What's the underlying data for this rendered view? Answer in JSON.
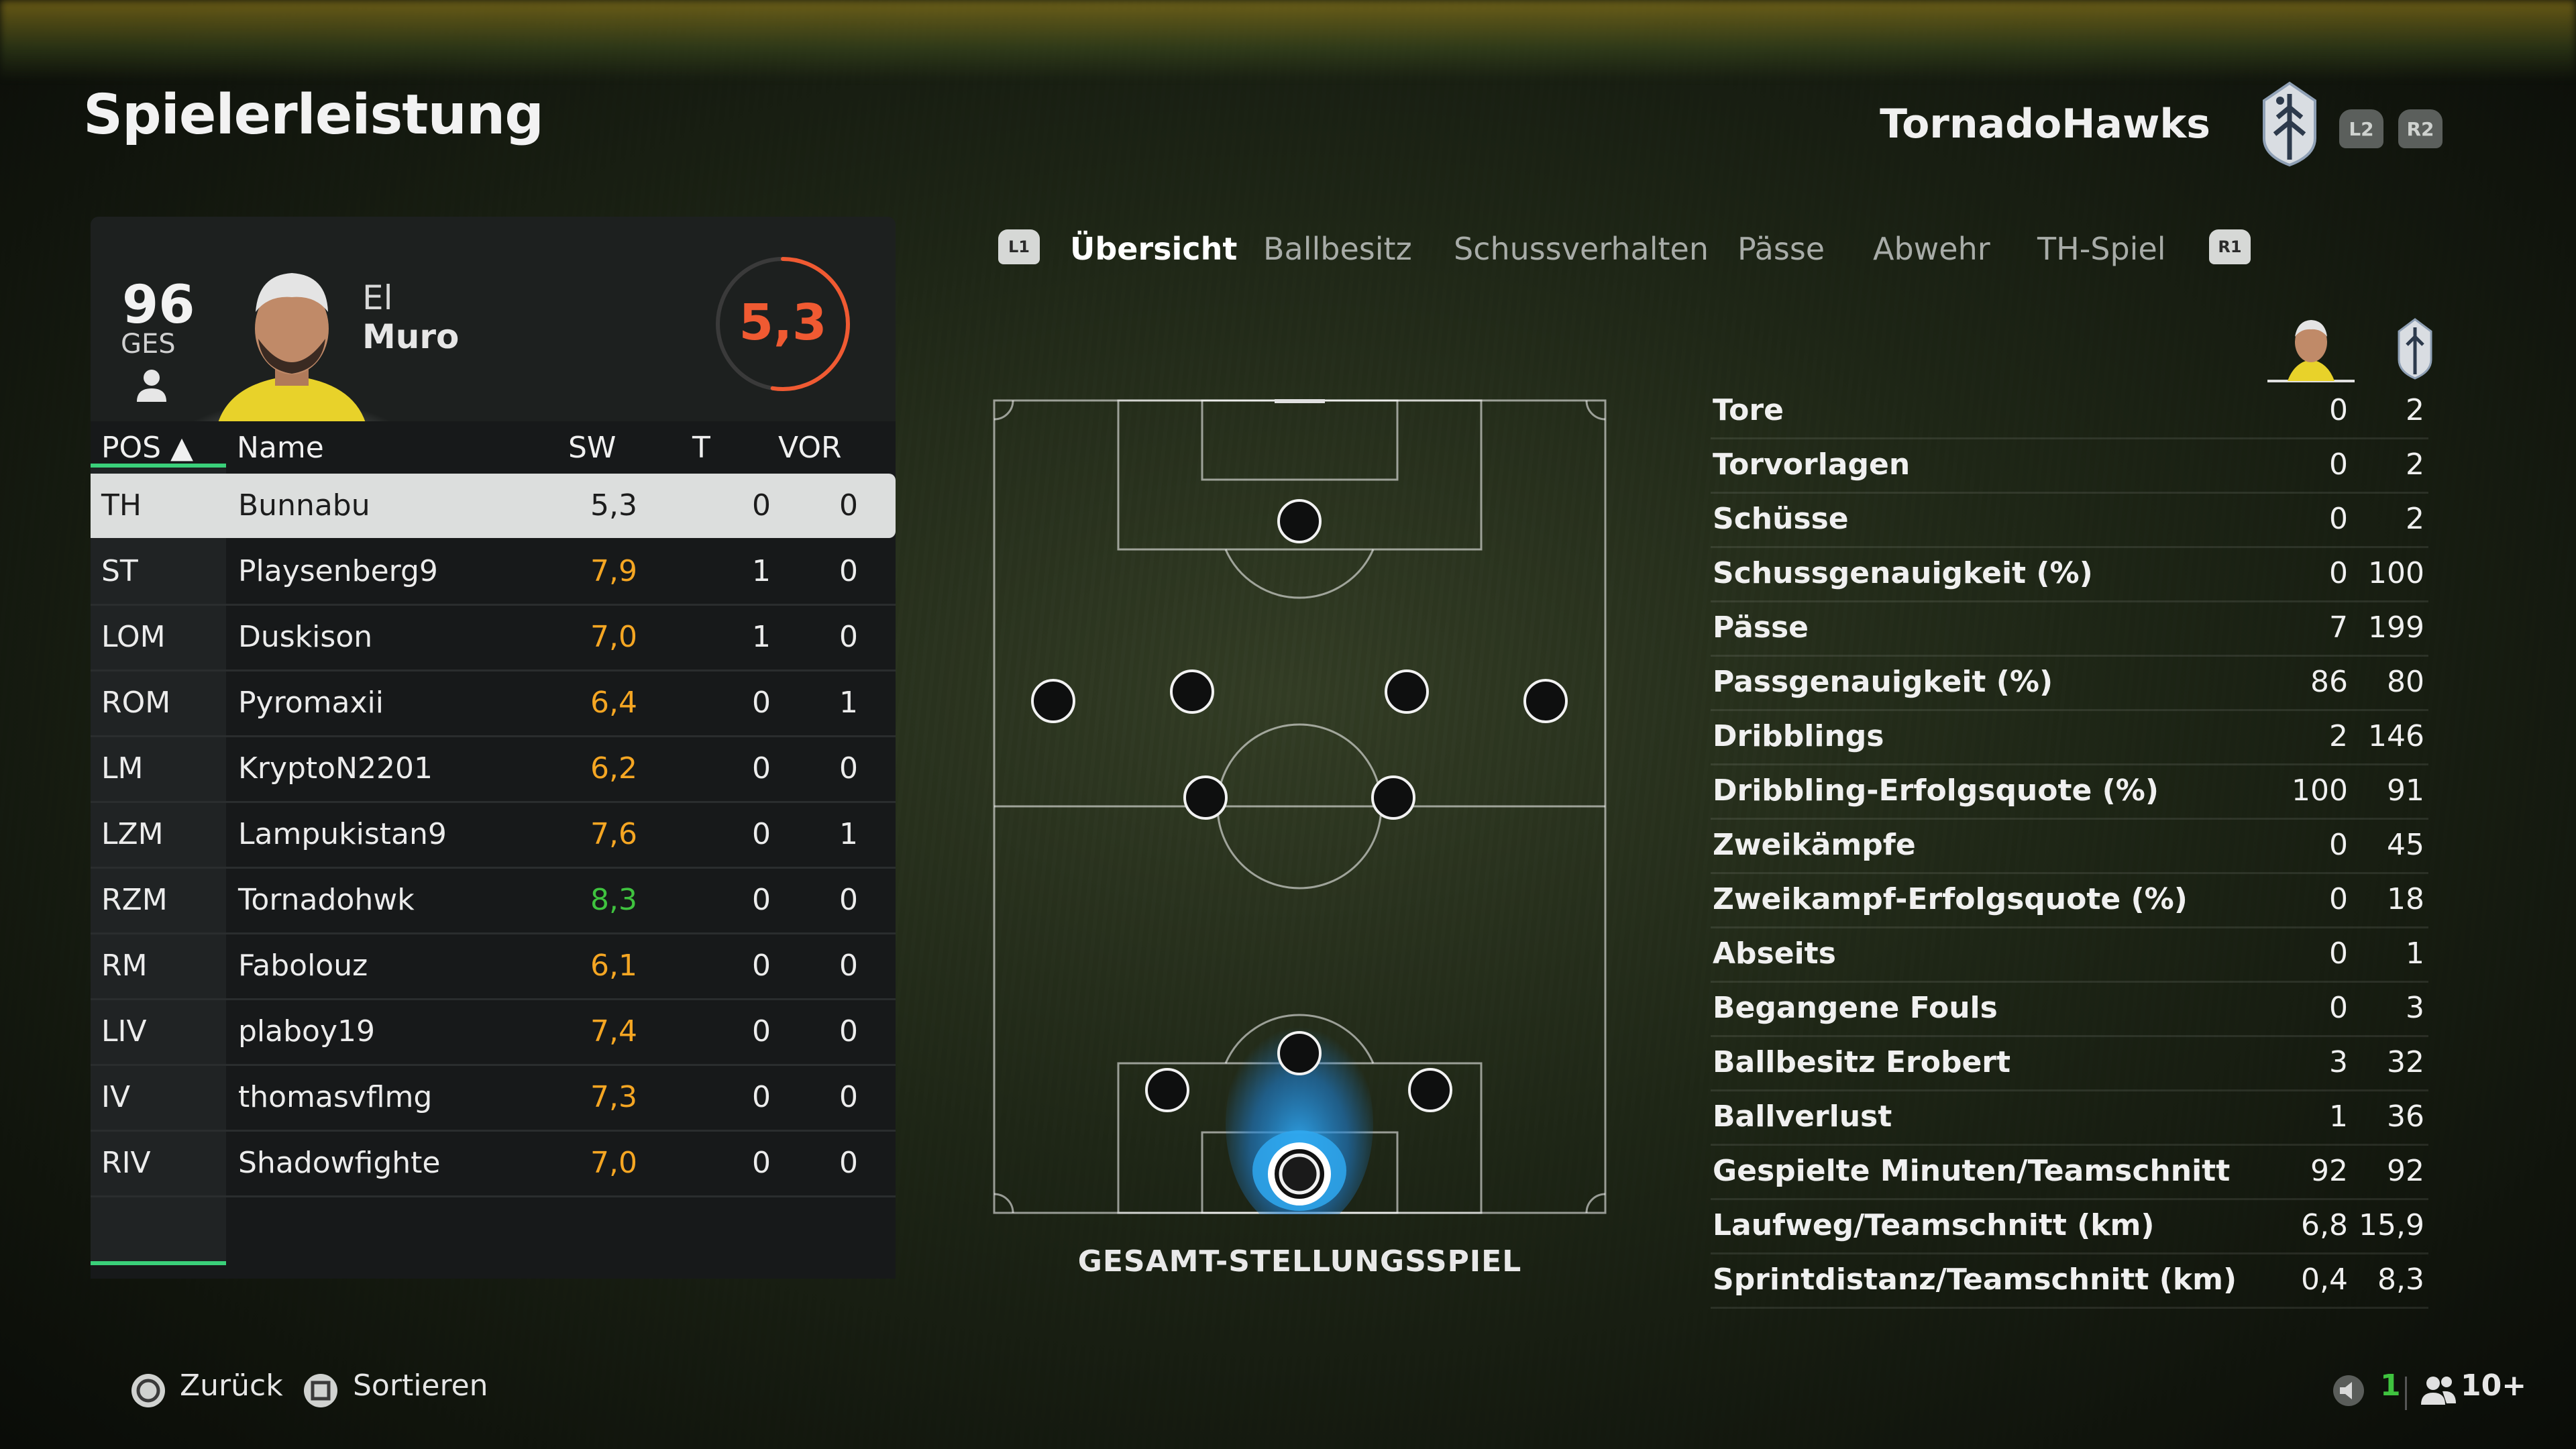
{
  "header": {
    "title": "Spielerleistung",
    "team_name": "TornadoHawks",
    "l2": "L2",
    "r2": "R2"
  },
  "player": {
    "ovr": "96",
    "ovr_label": "GES",
    "first_name": "El",
    "last_name": "Muro",
    "rating": "5,3"
  },
  "table": {
    "headers": {
      "pos": "POS ▲",
      "name": "Name",
      "sw": "SW",
      "t": "T",
      "vor": "VOR"
    },
    "rows": [
      {
        "pos": "TH",
        "name": "Bunnabu",
        "sw": "5,3",
        "t": "0",
        "vor": "0",
        "color": "#1c1c1c"
      },
      {
        "pos": "ST",
        "name": "Playsenberg9",
        "sw": "7,9",
        "t": "1",
        "vor": "0",
        "color": "#f5a623"
      },
      {
        "pos": "LOM",
        "name": "Duskison",
        "sw": "7,0",
        "t": "1",
        "vor": "0",
        "color": "#f5a623"
      },
      {
        "pos": "ROM",
        "name": "Pyromaxii",
        "sw": "6,4",
        "t": "0",
        "vor": "1",
        "color": "#f5a623"
      },
      {
        "pos": "LM",
        "name": "KryptoN2201",
        "sw": "6,2",
        "t": "0",
        "vor": "0",
        "color": "#f5a623"
      },
      {
        "pos": "LZM",
        "name": "Lampukistan9",
        "sw": "7,6",
        "t": "0",
        "vor": "1",
        "color": "#f5a623"
      },
      {
        "pos": "RZM",
        "name": "Tornadohwk",
        "sw": "8,3",
        "t": "0",
        "vor": "0",
        "color": "#3fc33f"
      },
      {
        "pos": "RM",
        "name": "Fabolouz",
        "sw": "6,1",
        "t": "0",
        "vor": "0",
        "color": "#f5a623"
      },
      {
        "pos": "LIV",
        "name": "plaboy19",
        "sw": "7,4",
        "t": "0",
        "vor": "0",
        "color": "#f5a623"
      },
      {
        "pos": "IV",
        "name": "thomasvflmg",
        "sw": "7,3",
        "t": "0",
        "vor": "0",
        "color": "#f5a623"
      },
      {
        "pos": "RIV",
        "name": "Shadowfighte",
        "sw": "7,0",
        "t": "0",
        "vor": "0",
        "color": "#f5a623"
      }
    ]
  },
  "tabs": {
    "l1": "L1",
    "r1": "R1",
    "items": [
      "Übersicht",
      "Ballbesitz",
      "Schussverhalten",
      "Pässe",
      "Abwehr",
      "TH-Spiel"
    ]
  },
  "pitch_label": "GESAMT-STELLUNGSSPIEL",
  "stats": [
    {
      "label": "Tore",
      "player": "0",
      "team": "2"
    },
    {
      "label": "Torvorlagen",
      "player": "0",
      "team": "2"
    },
    {
      "label": "Schüsse",
      "player": "0",
      "team": "2"
    },
    {
      "label": "Schussgenauigkeit (%)",
      "player": "0",
      "team": "100"
    },
    {
      "label": "Pässe",
      "player": "7",
      "team": "199"
    },
    {
      "label": "Passgenauigkeit (%)",
      "player": "86",
      "team": "80"
    },
    {
      "label": "Dribblings",
      "player": "2",
      "team": "146"
    },
    {
      "label": "Dribbling-Erfolgsquote (%)",
      "player": "100",
      "team": "91"
    },
    {
      "label": "Zweikämpfe",
      "player": "0",
      "team": "45"
    },
    {
      "label": "Zweikampf-Erfolgsquote (%)",
      "player": "0",
      "team": "18"
    },
    {
      "label": "Abseits",
      "player": "0",
      "team": "1"
    },
    {
      "label": "Begangene Fouls",
      "player": "0",
      "team": "3"
    },
    {
      "label": "Ballbesitz Erobert",
      "player": "3",
      "team": "32"
    },
    {
      "label": "Ballverlust",
      "player": "1",
      "team": "36"
    },
    {
      "label": "Gespielte Minuten/Teamschnitt",
      "player": "92",
      "team": "92"
    },
    {
      "label": "Laufweg/Teamschnitt (km)",
      "player": "6,8",
      "team": "15,9"
    },
    {
      "label": "Sprintdistanz/Teamschnitt (km)",
      "player": "0,4",
      "team": "8,3"
    }
  ],
  "footer": {
    "back": "Zurück",
    "sort": "Sortieren",
    "count": "1",
    "players": "10+"
  },
  "colors": {
    "accent_green": "#3ad07a",
    "rating_orange": "#f05a32",
    "heat_blue": "#2fa8f0"
  }
}
